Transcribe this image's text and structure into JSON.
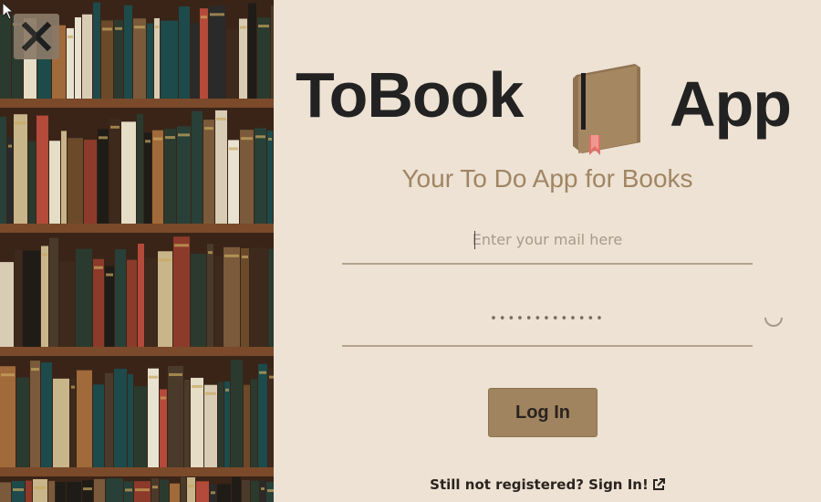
{
  "close_button": {
    "icon": "close-icon"
  },
  "brand": {
    "title_left": "ToBook",
    "title_right": "App",
    "logo_icon": "book-icon",
    "colors": {
      "book_cover": "#a58762",
      "bookmark": "#e0706a",
      "text": "#222222"
    }
  },
  "tagline": "Your To Do App for Books",
  "email": {
    "placeholder": "Enter your mail here",
    "value": ""
  },
  "password": {
    "masked_value": "•••••••••••••"
  },
  "login_button": {
    "label": "Log In"
  },
  "signin": {
    "text": "Still not registered? Sign In!",
    "icon": "external-link-icon"
  },
  "colors": {
    "background": "#ede2d3",
    "accent": "#a0845f",
    "underline": "#b5a48d"
  }
}
